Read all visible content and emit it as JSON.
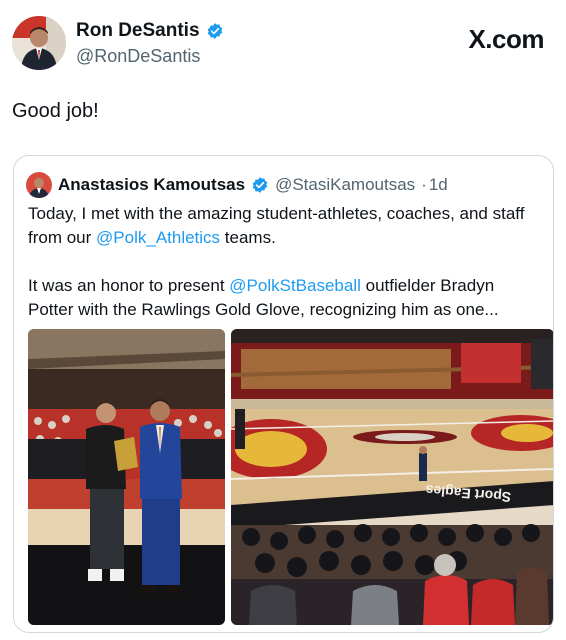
{
  "post": {
    "author_name": "Ron DeSantis",
    "author_handle": "@RonDeSantis",
    "verified_icon": "verified-badge-icon",
    "site_label": "X.com",
    "text": "Good job!"
  },
  "quoted": {
    "author_name": "Anastasios Kamoutsas",
    "author_handle": "@StasiKamoutsas",
    "separator": "·",
    "time": "1d",
    "p1_before": "Today, I met with the amazing student-athletes, coaches, and staff from our ",
    "p1_link": "@Polk_Athletics",
    "p1_after": " teams.",
    "p2_before": "It was an honor to present ",
    "p2_link": "@PolkStBaseball",
    "p2_after": " outfielder Bradyn Potter with the Rawlings Gold Glove, recognizing him as one...",
    "gym_banner": "Sport Eagles"
  },
  "colors": {
    "link": "#1d9bf0",
    "verified": "#1d9bf0",
    "text": "#0f1419",
    "secondary": "#536471"
  }
}
